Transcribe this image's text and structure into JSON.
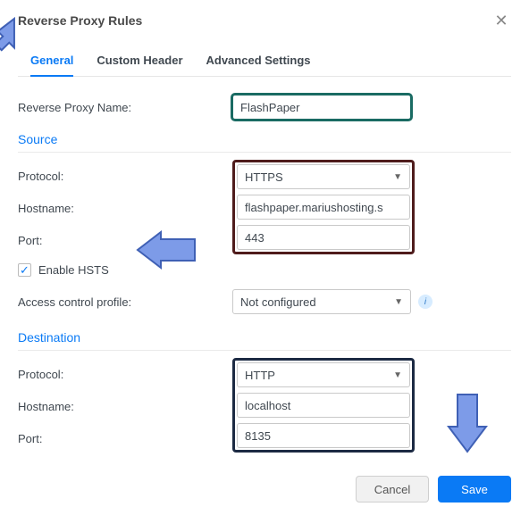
{
  "dialog": {
    "title": "Reverse Proxy Rules",
    "close_icon": "✕"
  },
  "tabs": {
    "general": "General",
    "custom_header": "Custom Header",
    "advanced": "Advanced Settings"
  },
  "labels": {
    "name": "Reverse Proxy Name:",
    "protocol": "Protocol:",
    "hostname": "Hostname:",
    "port": "Port:",
    "enable_hsts": "Enable HSTS",
    "access_profile": "Access control profile:"
  },
  "sections": {
    "source": "Source",
    "destination": "Destination"
  },
  "values": {
    "name": "FlashPaper",
    "src_protocol": "HTTPS",
    "src_hostname": "flashpaper.mariushosting.s",
    "src_port": "443",
    "hsts_checked": "✓",
    "access_profile": "Not configured",
    "dst_protocol": "HTTP",
    "dst_hostname": "localhost",
    "dst_port": "8135"
  },
  "buttons": {
    "cancel": "Cancel",
    "save": "Save"
  },
  "info_icon": "i",
  "caret": "▼"
}
